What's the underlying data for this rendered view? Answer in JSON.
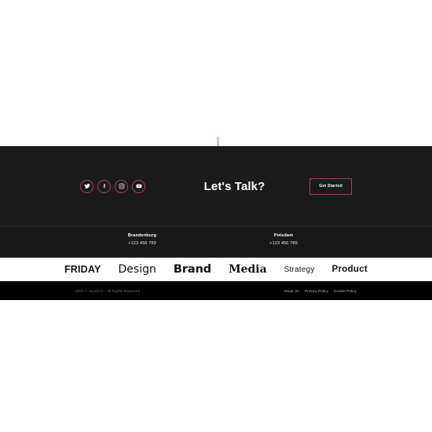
{
  "accent_color": "#b3456a",
  "cta": {
    "title": "Let's Talk?",
    "button_label": "Get Started",
    "socials": [
      {
        "name": "twitter",
        "label": "Twitter"
      },
      {
        "name": "facebook",
        "label": "Facebook"
      },
      {
        "name": "instagram",
        "label": "Instagram"
      },
      {
        "name": "youtube",
        "label": "YouTube"
      }
    ]
  },
  "locations": [
    {
      "city": "Brandenburg",
      "phone": "+123 456 789"
    },
    {
      "city": "Potsdam",
      "phone": "+123 456 789"
    }
  ],
  "type_strip": {
    "words": [
      {
        "text": "FRIDAY"
      },
      {
        "text": "Design"
      },
      {
        "text": "Brand"
      },
      {
        "text": "Media"
      },
      {
        "text": "Strategy"
      },
      {
        "text": "Product"
      }
    ]
  },
  "footer": {
    "copyright": "2025 © Studio74 - All Rights Reserved",
    "links": [
      {
        "label": "About Us"
      },
      {
        "label": "Privacy Policy"
      },
      {
        "label": "Cookie Policy"
      }
    ]
  }
}
